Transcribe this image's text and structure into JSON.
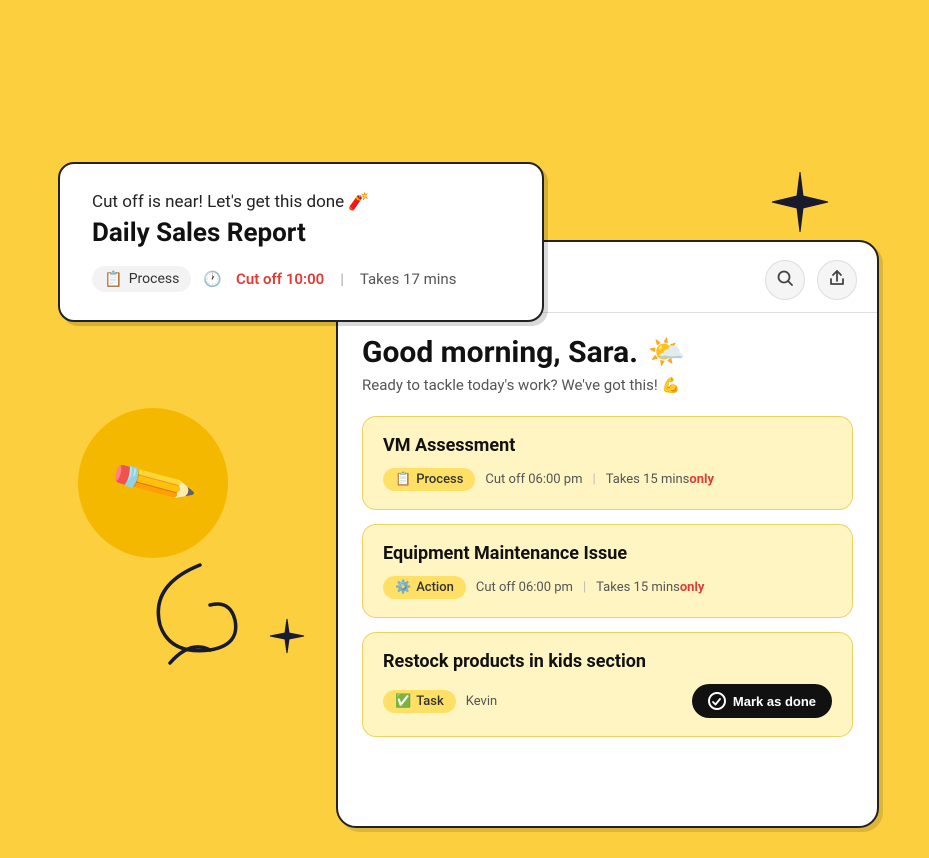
{
  "background_color": "#FCCF3F",
  "notification": {
    "tagline": "Cut off is near! Let's get this done 🧨",
    "title": "Daily Sales Report",
    "process_label": "Process",
    "cutoff_label": "Cut off 10:00",
    "separator": "|",
    "takes_label": "Takes 17 mins",
    "process_icon": "📋"
  },
  "header": {
    "search_icon": "search",
    "share_icon": "share"
  },
  "greeting": {
    "text": "Good morning, Sara.",
    "weather_emoji": "🌤️",
    "subtitle": "Ready to tackle today's work? We've got this! 💪"
  },
  "tasks": [
    {
      "title": "VM Assessment",
      "tag_label": "Process",
      "tag_icon": "📋",
      "cutoff": "Cut off 06:00 pm",
      "separator": "|",
      "takes": "Takes 15 mins",
      "only": "only",
      "show_mark_done": false
    },
    {
      "title": "Equipment Maintenance Issue",
      "tag_label": "Action",
      "tag_icon": "⚙️",
      "cutoff": "Cut off 06:00 pm",
      "separator": "|",
      "takes": "Takes 15 mins",
      "only": "only",
      "show_mark_done": false
    },
    {
      "title": "Restock products in kids section",
      "tag_label": "Task",
      "tag_icon": "✅",
      "person": "Kevin",
      "show_mark_done": true,
      "mark_done_label": "Mark as done"
    }
  ],
  "icons": {
    "process_icon": "📋",
    "action_icon": "⚙️",
    "task_icon": "✅",
    "search": "🔍",
    "share": "⬆"
  }
}
